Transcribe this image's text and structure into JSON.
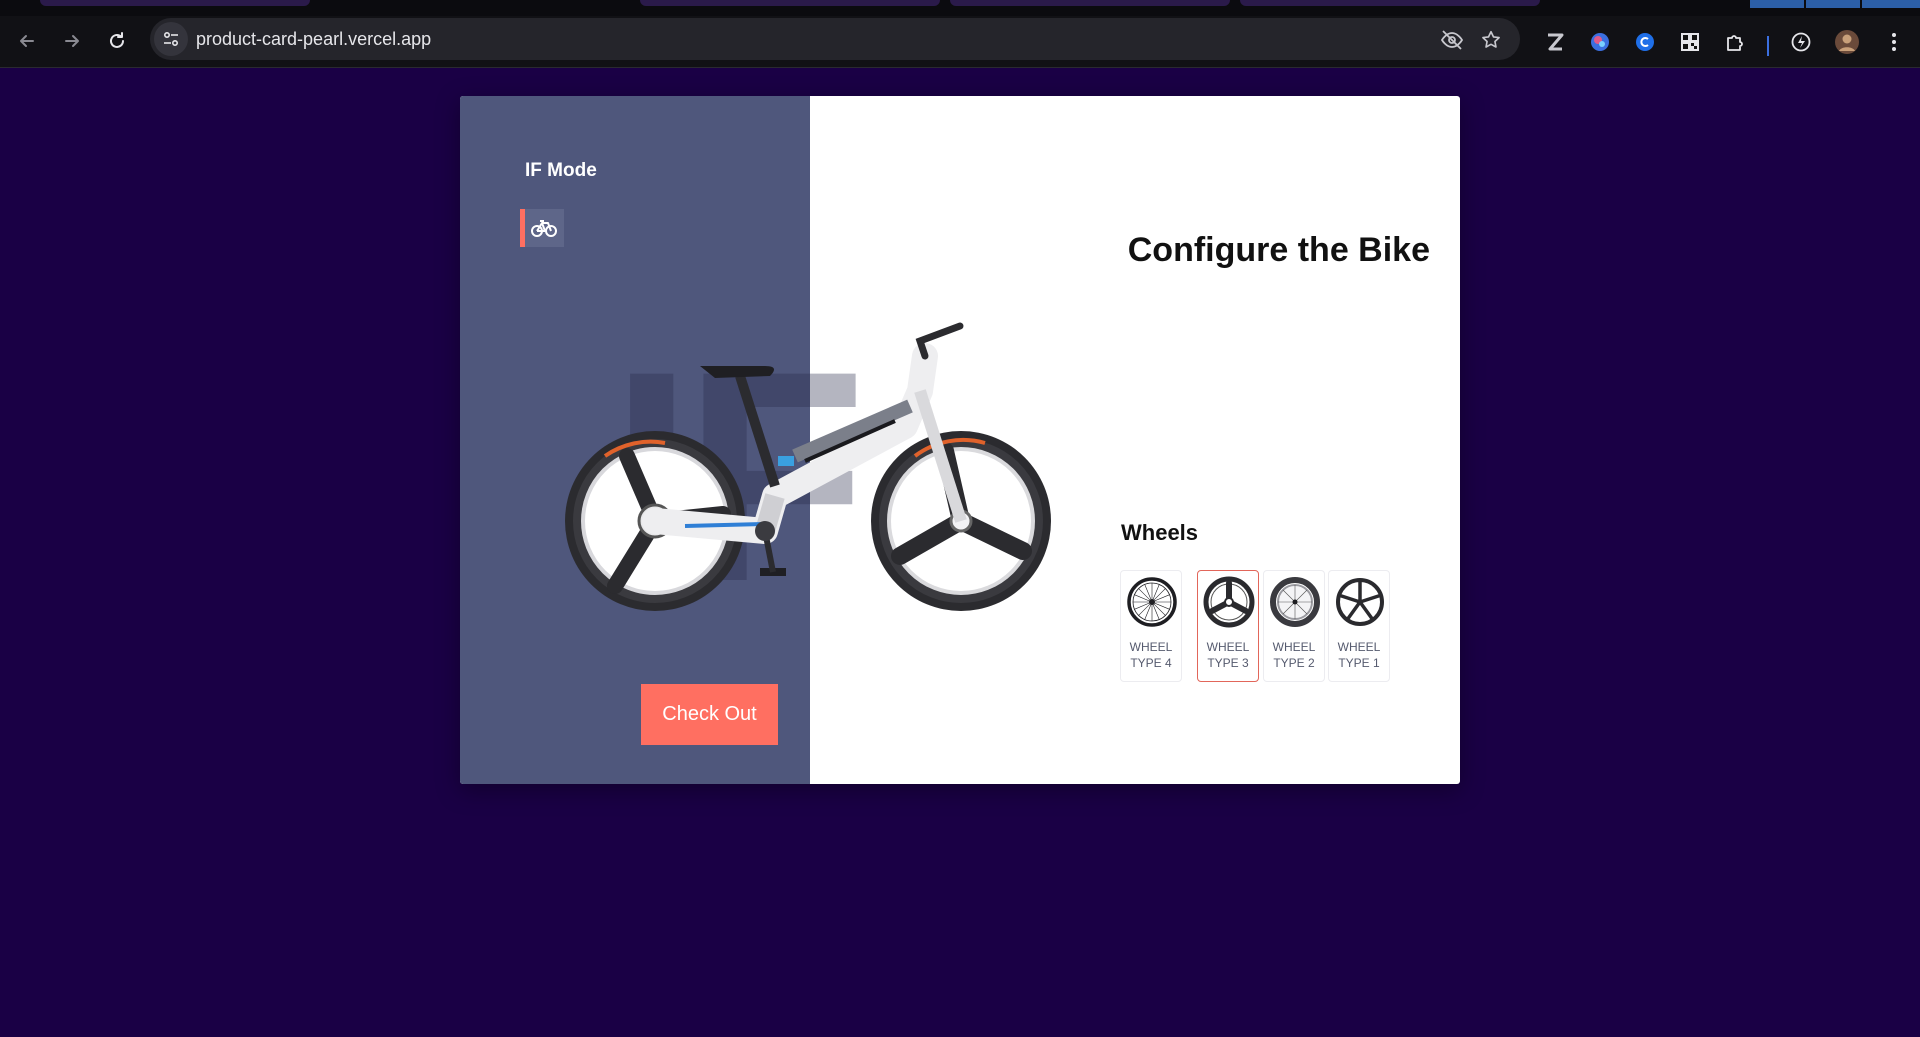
{
  "browser": {
    "url": "product-card-pearl.vercel.app",
    "icons": [
      "back-icon",
      "forward-icon",
      "reload-icon",
      "site-info-icon",
      "eye-off-icon",
      "star-icon",
      "extension-z-icon",
      "extension-orb-icon",
      "extension-blue-icon",
      "extension-qr-icon",
      "puzzle-icon",
      "extension-bolt-icon",
      "profile-avatar",
      "more-menu-icon"
    ]
  },
  "product": {
    "mode_title": "IF Mode",
    "mode_icon": "bicycle-icon",
    "watermark": "IF",
    "checkout_label": "Check Out",
    "config_title": "Configure the Bike",
    "wheels_heading": "Wheels",
    "wheels": [
      {
        "line1": "WHEEL",
        "line2": "TYPE 4",
        "selected": false,
        "icon": "wheel-spoked-icon"
      },
      {
        "line1": "WHEEL",
        "line2": "TYPE 3",
        "selected": true,
        "icon": "wheel-tri-spoke-icon"
      },
      {
        "line1": "WHEEL",
        "line2": "TYPE 2",
        "selected": false,
        "icon": "wheel-deep-rim-icon"
      },
      {
        "line1": "WHEEL",
        "line2": "TYPE 1",
        "selected": false,
        "icon": "wheel-five-spoke-icon"
      }
    ]
  },
  "colors": {
    "page_bg": "#1a0045",
    "panel_bg": "#4f577c",
    "accent": "#ff6f61",
    "card_bg": "#ffffff"
  }
}
